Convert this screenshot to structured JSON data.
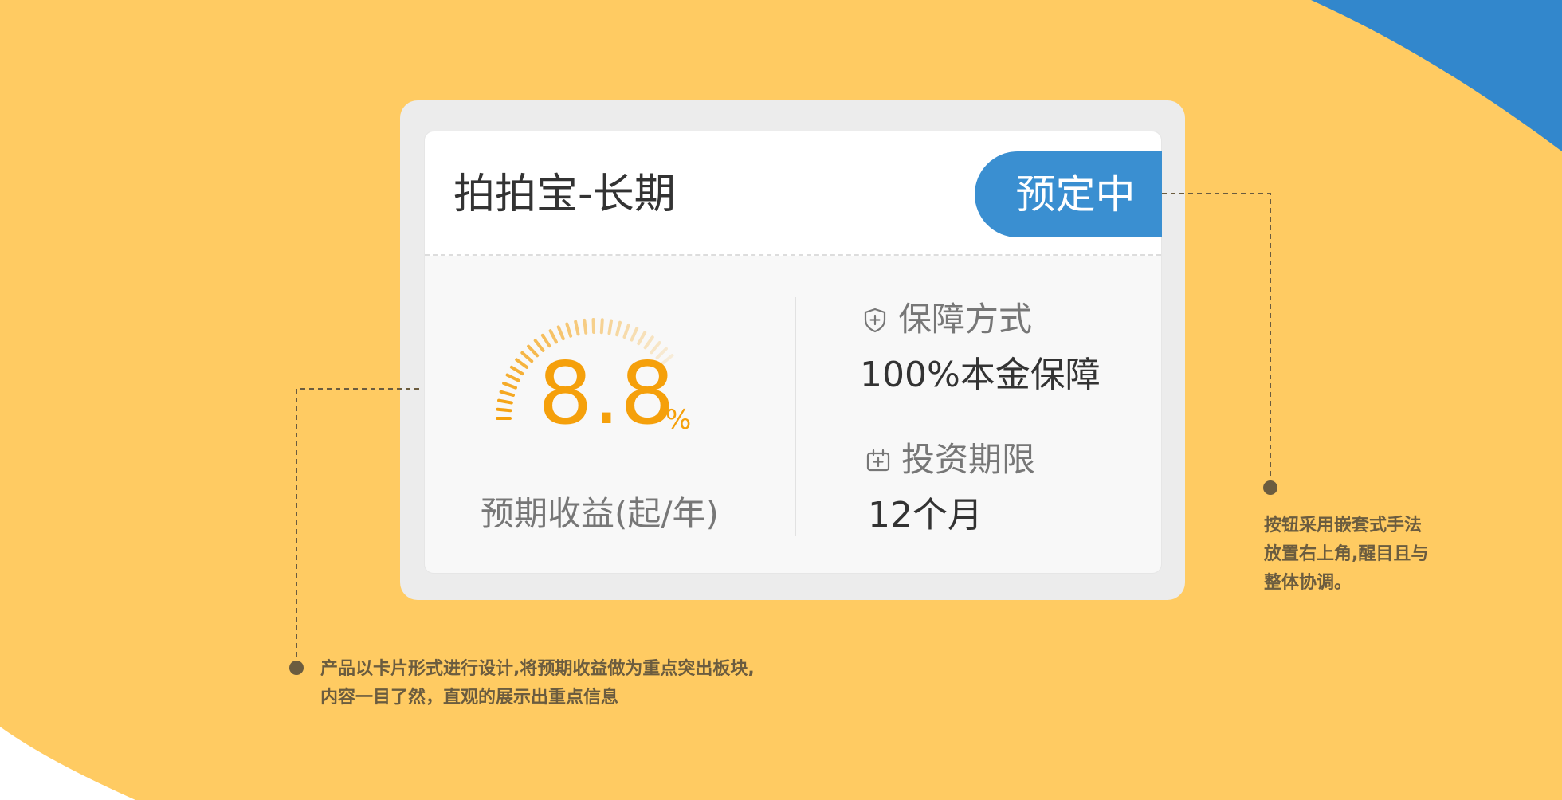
{
  "product": {
    "title": "拍拍宝-长期",
    "status_button": "预定中"
  },
  "rate": {
    "value": "8.8",
    "unit": "%",
    "label": "预期收益(起/年)"
  },
  "guarantee": {
    "label": "保障方式",
    "value": "100%本金保障",
    "icon": "shield-icon"
  },
  "term": {
    "label": "投资期限",
    "value": "12个月",
    "icon": "calendar-icon"
  },
  "notes": {
    "right_lines": [
      "按钮采用嵌套式手法",
      "放置右上角,醒目且与",
      "整体协调。"
    ],
    "left_lines": [
      "产品以卡片形式进行设计,将预期收益做为重点突出板块,",
      "内容一目了然，直观的展示出重点信息"
    ]
  },
  "colors": {
    "background_yellow": "#ffcb62",
    "accent_blue": "#3a8fd1",
    "rate_orange": "#f5a00b",
    "note_text": "#6b5c3f"
  }
}
